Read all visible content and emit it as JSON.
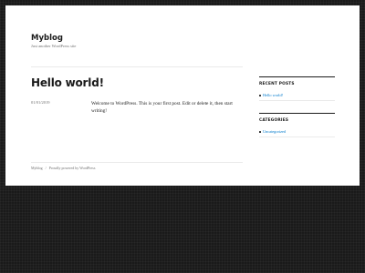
{
  "site": {
    "title": "Myblog",
    "description": "Just another WordPress site"
  },
  "post": {
    "title": "Hello world!",
    "date": "01/01/2019",
    "content": "Welcome to WordPress. This is your first post. Edit or delete it, then start writing!"
  },
  "sidebar": {
    "recent_posts": {
      "title": "Recent Posts",
      "items": [
        {
          "label": "Hello world!"
        }
      ]
    },
    "categories": {
      "title": "Categories",
      "items": [
        {
          "label": "Uncategorized"
        }
      ]
    }
  },
  "footer": {
    "site_name": "Myblog",
    "separator": "/",
    "credit": "Proudly powered by WordPress"
  },
  "colors": {
    "page_background": "#ffffff",
    "outer_background": "#1a1a1a",
    "link": "#007acc",
    "text": "#1a1a1a",
    "muted": "#707070"
  }
}
